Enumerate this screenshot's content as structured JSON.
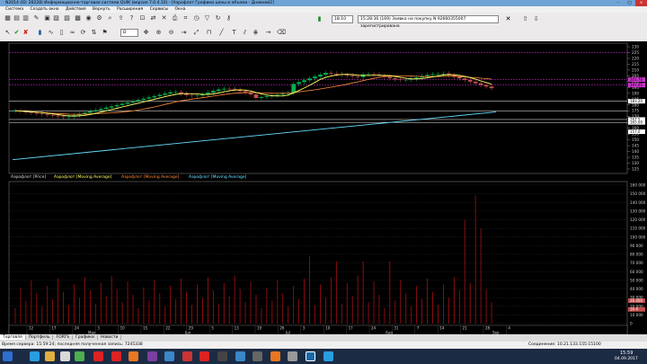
{
  "window": {
    "title": "N2014 (ID: 26228) Информационно-торговая система QUIK (версия 7.0.4.10) - [Аэрофлот Графики цены и объема - Дневной2]"
  },
  "menu": [
    "Система",
    "Создать окно",
    "Действия",
    "Вернуть",
    "Расширения",
    "Сервисы",
    "Окна"
  ],
  "toolbar": {
    "time_label": "18:10",
    "message": "15:28:36 (169) Заявка на покупку N 92660355007 зарегистрирована",
    "interval": "D"
  },
  "chart": {
    "legend_price": [
      "Аэрофлот [Price]",
      "Аэрофлот [Moving Average]",
      "Аэрофлот [Moving Average]",
      "Аэрофлот [Moving Average]"
    ],
    "legend_volume": "Аэрофлот [Volume]",
    "price_axis": [
      "230",
      "225",
      "220",
      "215",
      "210",
      "205",
      "200",
      "195",
      "190",
      "185",
      "180",
      "175",
      "170",
      "165",
      "160",
      "155",
      "150",
      "145",
      "140",
      "135",
      "130",
      "125"
    ],
    "price_tags": [
      "201.78",
      "197.05",
      "183.20",
      "167.5",
      "165.00",
      "157.0"
    ],
    "volume_axis": [
      "160 000",
      "150 000",
      "140 000",
      "130 000",
      "120 000",
      "110 000",
      "100 000",
      "90 000",
      "80 000",
      "70 000",
      "60 000",
      "50 000",
      "40 000",
      "30 000",
      "20 000",
      "10 000",
      "0"
    ],
    "volume_tags": [
      "26 400",
      "16 4"
    ],
    "date_row": [
      "12",
      "17",
      "24",
      "3",
      "10",
      "15",
      "22",
      "29",
      "5",
      "13",
      "19",
      "26",
      "3",
      "10",
      "17",
      "24",
      "31",
      "7",
      "14",
      "21",
      "28",
      "4"
    ],
    "month_row": [
      "May",
      "Jun",
      "Jul",
      "Aug",
      "Sep"
    ],
    "colors": {
      "price_up": "#00b050",
      "price_down": "#c0504d",
      "ma_fast": "#ffff66",
      "ma_slow": "#ff8a3d",
      "ma_long": "#66e0ff",
      "volume": "#a81010",
      "level_purple": "#cc33cc",
      "level_white": "#ffffff"
    }
  },
  "tabs": [
    "Торговля",
    "Портфель",
    "FORTS",
    "Графики",
    "Новости"
  ],
  "status": {
    "left": "Время сервера: 15:59:24; последняя полученная запись: 7245338",
    "right": "Соединение: 10.21.133.155:15100"
  },
  "taskbar": {
    "time": "15:59",
    "date": "04.09.2017"
  }
}
